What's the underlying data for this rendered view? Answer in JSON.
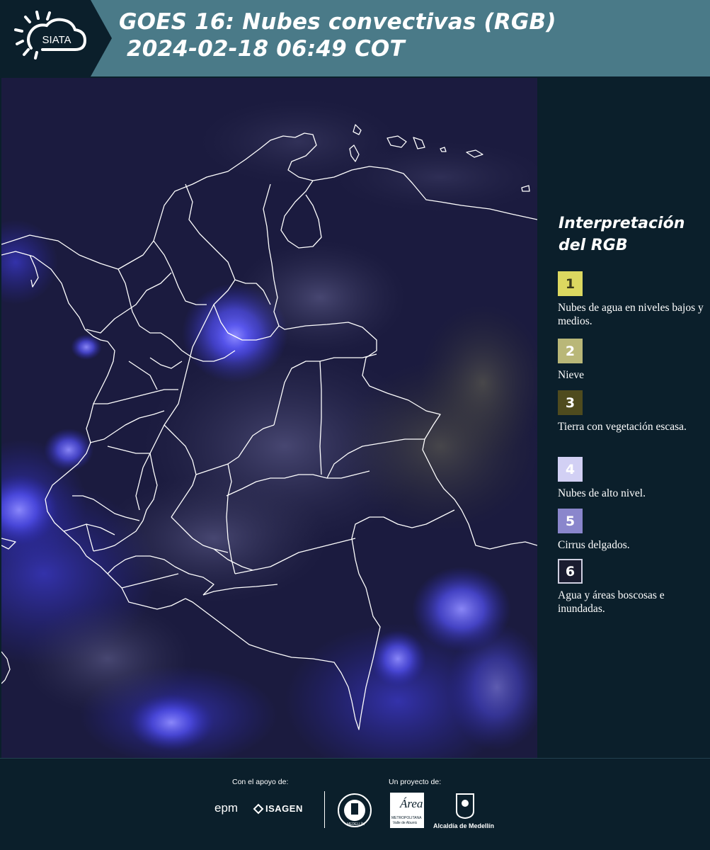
{
  "header": {
    "logo_text": "SIATA",
    "title": "GOES 16: Nubes convectivas (RGB)\n 2024-02-18 06:49 COT"
  },
  "legend": {
    "title": "Interpretación\ndel RGB",
    "items": [
      {
        "number": "1",
        "label": "Nubes de agua en niveles bajos y medios.",
        "color": "#dcd860",
        "text_color": "#3a3a1a"
      },
      {
        "number": "2",
        "label": "Nieve",
        "color": "#b9b778",
        "text_color": "#ffffff"
      },
      {
        "number": "3",
        "label": "Tierra con vegetación escasa.",
        "color": "#4f4b1e",
        "text_color": "#ffffff"
      },
      {
        "number": "4",
        "label": "Nubes de alto nivel.",
        "color": "#d2d0f4",
        "text_color": "#ffffff"
      },
      {
        "number": "5",
        "label": "Cirrus delgados.",
        "color": "#8a86cc",
        "text_color": "#ffffff"
      },
      {
        "number": "6",
        "label": "Agua y áreas boscosas e inundadas.",
        "color": "#1a1c30",
        "text_color": "#ffffff"
      }
    ]
  },
  "footer": {
    "support_label": "Con el apoyo de:",
    "project_label": "Un proyecto de:",
    "epm": "epm",
    "isagen": "ISAGEN",
    "area_name": "Área",
    "area_sub": "METROPOLITANA",
    "area_sub2": "Valle de Aburrá",
    "alcaldia": "Alcaldía de Medellín",
    "seal_text": "MEDELLÍN"
  },
  "colors": {
    "header_bg": "#4a7a88",
    "page_bg": "#0b1f2b",
    "map_bg": "#1a1a3e",
    "border_line": "#ffffff"
  }
}
